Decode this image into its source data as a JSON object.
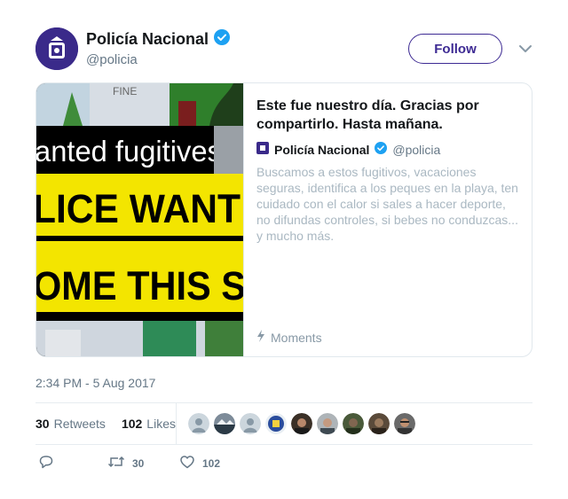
{
  "tweet": {
    "author_name": "Policía Nacional",
    "author_handle": "@policia",
    "follow_label": "Follow",
    "timestamp": "2:34 PM - 5 Aug 2017"
  },
  "card": {
    "title": "Este fue nuestro día. Gracias por compartirlo. Hasta mañana.",
    "author_name": "Policía Nacional",
    "author_handle": "@policia",
    "description": "Buscamos a estos fugitivos, vacaciones seguras, identifica a los peques en la playa, ten cuidado con el calor si sales a hacer deporte, no difundas controles, si bebes no conduzcas... y mucho más.",
    "source_label": "Moments",
    "image_lines": [
      "anted fugitives,",
      "LICE WANT",
      "OME THIS S"
    ],
    "image_top_fragment": "FINE"
  },
  "stats": {
    "retweets_count": "30",
    "retweets_label": "Retweets",
    "likes_count": "102",
    "likes_label": "Likes"
  },
  "actions": {
    "retweet_count": "30",
    "like_count": "102"
  },
  "colors": {
    "brand": "#3d2a93",
    "verified": "#1da1f2",
    "card_yellow": "#f3e500"
  },
  "icons": [
    "verified-badge-icon",
    "chevron-down-icon",
    "lightning-icon",
    "reply-icon",
    "retweet-icon",
    "heart-icon"
  ]
}
